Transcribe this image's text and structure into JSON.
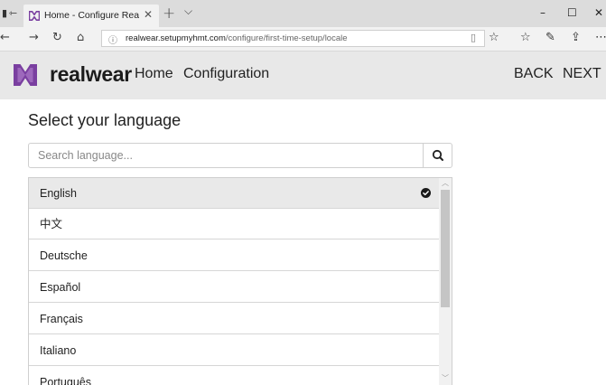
{
  "browser": {
    "tab_title": "Home - Configure RealW",
    "address": {
      "host": "realwear.setupmyhmt.com",
      "path": "/configure/first-time-setup/locale"
    }
  },
  "app": {
    "brand": "realwear",
    "nav": {
      "home": "Home",
      "configuration": "Configuration"
    },
    "actions": {
      "back": "BACK",
      "next": "NEXT"
    },
    "brand_color": "#7a3fa0"
  },
  "page": {
    "title": "Select your language",
    "search": {
      "placeholder": "Search language...",
      "value": ""
    },
    "languages": [
      {
        "label": "English",
        "selected": true
      },
      {
        "label": "中文",
        "selected": false
      },
      {
        "label": "Deutsche",
        "selected": false
      },
      {
        "label": "Español",
        "selected": false
      },
      {
        "label": "Français",
        "selected": false
      },
      {
        "label": "Italiano",
        "selected": false
      },
      {
        "label": "Português",
        "selected": false
      }
    ]
  }
}
